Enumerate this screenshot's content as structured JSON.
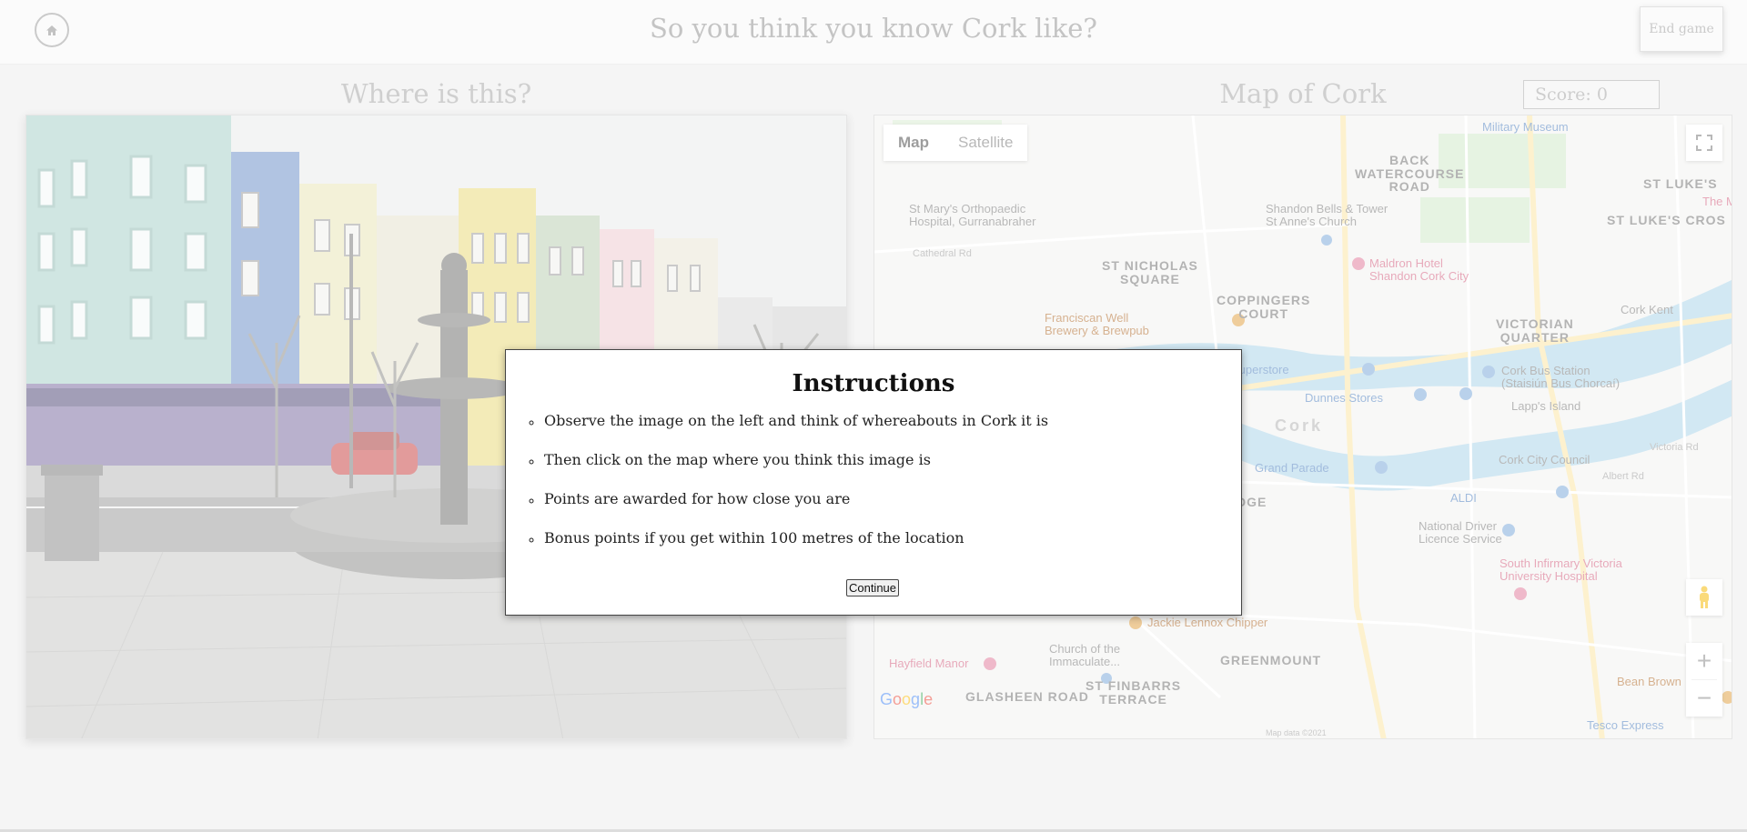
{
  "header": {
    "title": "So you think you know Cork like?",
    "end_game_label": "End game",
    "home_icon": "home-icon"
  },
  "photo_panel": {
    "heading": "Where is this?"
  },
  "map_panel": {
    "heading": "Map of Cork",
    "score_label": "Score: 0",
    "map_type": {
      "map": "Map",
      "satellite": "Satellite"
    },
    "google_logo": "Google",
    "attribution": "Map data ©2021",
    "labels": {
      "back_watercourse_road": "BACK\nWATERCOURSE\nROAD",
      "st_lukes": "ST LUKE'S",
      "st_lukes_cross": "ST LUKE'S CROS",
      "st_nicholas_square": "ST NICHOLAS\nSQUARE",
      "coppingers_court": "COPPINGERS\nCOURT",
      "victorian_quarter": "VICTORIAN\nQUARTER",
      "greenmount": "GREENMOUNT",
      "st_finbarrs_terrace": "ST FINBARRS\nTERRACE",
      "glasheen_road": "GLASHEEN ROAD",
      "cork": "Cork",
      "orthopaedic": "St Mary's Orthopaedic\nHospital, Gurranabraher",
      "shandon_bells": "Shandon Bells & Tower\nSt Anne's Church",
      "maldron": "Maldron Hotel\nShandon Cork City",
      "franciscan_well": "Franciscan Well\nBrewery & Brewpub",
      "superstore": "Superstore",
      "dunnes": "Dunnes Stores",
      "cork_bus_station": "Cork Bus Station\n(Staisiún Bus Chorcaí)",
      "lapps_island": "Lapp's Island",
      "cork_kent": "Cork Kent",
      "grand_parade": "Grand Parade",
      "cork_city_council": "Cork City Council",
      "aldi": "ALDI",
      "national_driver": "National Driver\nLicence Service",
      "south_infirmary": "South Infirmary Victoria\nUniversity Hospital",
      "jackie_lennox": "Jackie Lennox Chipper",
      "church_immaculate": "Church of the\nImmaculate...",
      "hayfield_manor": "Hayfield Manor",
      "bean_brown": "Bean Brown",
      "tesco_express": "Tesco Express",
      "military_museum": "Military Museum",
      "cathedral_rd": "Cathedral Rd",
      "albert_rd": "Albert Rd",
      "victoria_rd": "Victoria Rd",
      "the_m": "The M",
      "edge_fragment": "DGE"
    }
  },
  "modal": {
    "title": "Instructions",
    "items": [
      "Observe the image on the left and think of whereabouts in Cork it is",
      "Then click on the map where you think this image is",
      "Points are awarded for how close you are",
      "Bonus points if you get within 100 metres of the location"
    ],
    "continue_label": "Continue"
  }
}
